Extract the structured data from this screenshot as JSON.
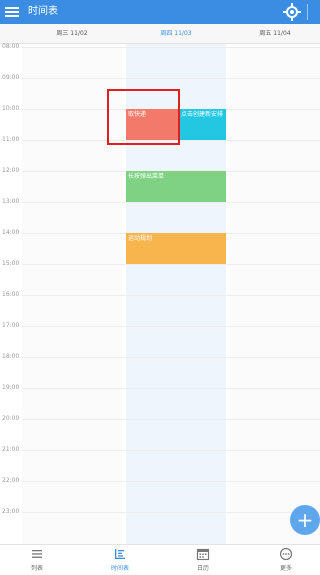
{
  "app": {
    "title": "时间表"
  },
  "days": [
    {
      "label": "周三 11/02",
      "active": false
    },
    {
      "label": "周四 11/03",
      "active": true
    },
    {
      "label": "周五 11/04",
      "active": false
    }
  ],
  "hours": [
    "08:00",
    "09:00",
    "10:00",
    "11:00",
    "12:00",
    "13:00",
    "14:00",
    "15:00",
    "16:00",
    "17:00",
    "18:00",
    "19:00",
    "20:00",
    "21:00",
    "22:00",
    "23:00"
  ],
  "events": [
    {
      "name": "取快递",
      "color": "#f37a6b"
    },
    {
      "name": "点击创建新安排",
      "color": "#23c7e2"
    },
    {
      "name": "长按弹出菜单",
      "color": "#7fd283"
    },
    {
      "name": "运动规划",
      "color": "#f8b54e"
    }
  ],
  "fab": {
    "symbol": "+"
  },
  "bottom_nav": [
    {
      "label": "列表",
      "icon": "list-icon",
      "active": false
    },
    {
      "label": "时间表",
      "icon": "timeline-icon",
      "active": true
    },
    {
      "label": "日历",
      "icon": "calendar-icon",
      "active": false
    },
    {
      "label": "更多",
      "icon": "more-icon",
      "active": false
    }
  ]
}
